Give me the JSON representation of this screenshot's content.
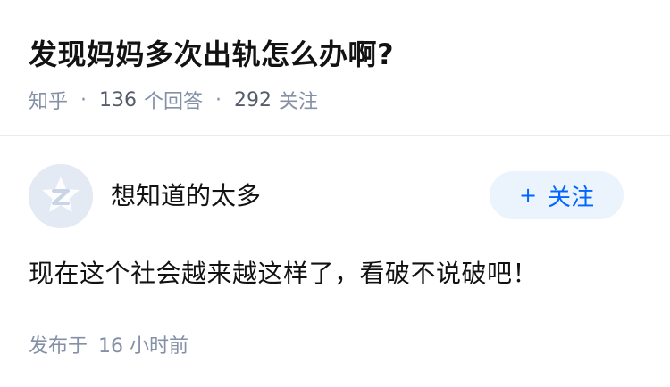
{
  "question": {
    "title": "发现妈妈多次出轨怎么办啊?",
    "site_name": "知乎",
    "separator": "·",
    "answer_count": "136",
    "answer_label": "个回答",
    "follower_count": "292",
    "follower_label": "关注"
  },
  "answer": {
    "author": "想知道的太多",
    "follow_icon": "plus-icon",
    "follow_plus": "+",
    "follow_label": "关注",
    "content": "现在这个社会越来越这样了，看破不说破吧！",
    "published_label": "发布于",
    "published_time": "16 小时前"
  },
  "colors": {
    "title": "#121212",
    "meta": "#8590a6",
    "accent": "#0066ff",
    "follow_bg": "#ebf3fc",
    "avatar_bg": "#e6ecf5"
  }
}
